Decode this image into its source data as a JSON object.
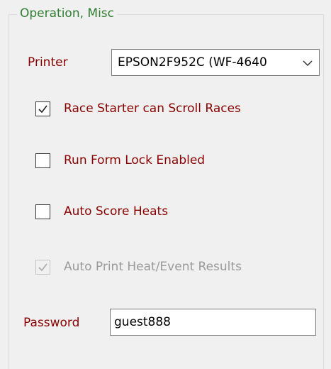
{
  "group": {
    "title": "Operation, Misc"
  },
  "printer": {
    "label": "Printer",
    "selected": "EPSON2F952C (WF-4640",
    "icon": "chevron-down-icon"
  },
  "checkboxes": [
    {
      "label": "Race Starter can Scroll Races",
      "checked": true,
      "enabled": true
    },
    {
      "label": "Run Form Lock Enabled",
      "checked": false,
      "enabled": true
    },
    {
      "label": "Auto Score Heats",
      "checked": false,
      "enabled": true
    },
    {
      "label": "Auto Print Heat/Event Results",
      "checked": true,
      "enabled": false
    }
  ],
  "password": {
    "label": "Password",
    "value": "guest888"
  },
  "colors": {
    "group_title": "#2e7d32",
    "label": "#8b0000",
    "disabled_label": "#9a9a9a"
  }
}
